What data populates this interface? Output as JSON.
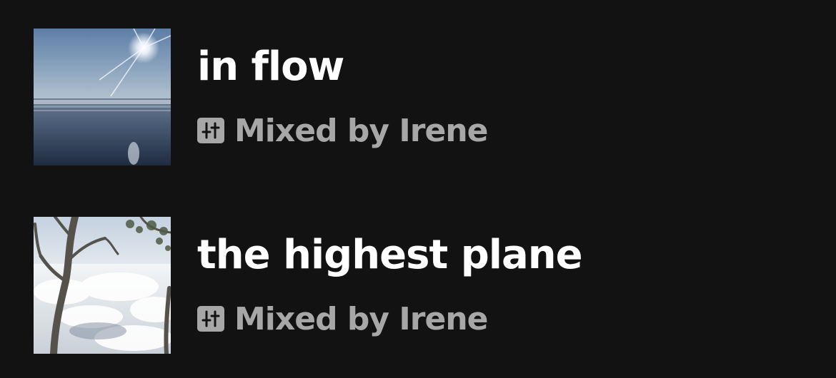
{
  "playlists": [
    {
      "title": "in flow",
      "subtitle": "Mixed by Irene",
      "cover": "ocean-sun-cover",
      "subtitle_icon": "mixer-icon"
    },
    {
      "title": "the highest plane",
      "subtitle": "Mixed by Irene",
      "cover": "clouds-tree-cover",
      "subtitle_icon": "mixer-icon"
    }
  ],
  "colors": {
    "background": "#121212",
    "title": "#ffffff",
    "subtitle": "#a7a7a7"
  }
}
